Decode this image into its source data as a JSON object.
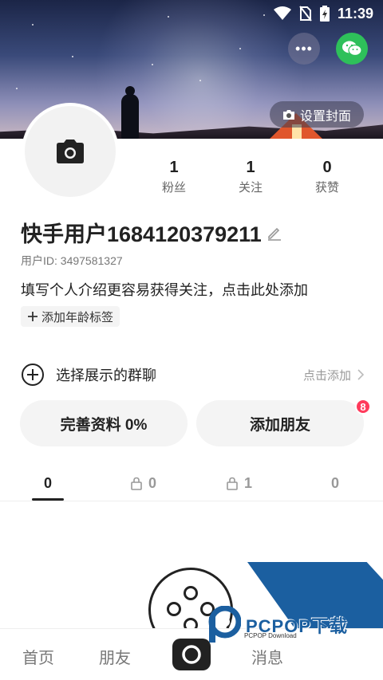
{
  "status_bar": {
    "time": "11:39"
  },
  "cover": {
    "set_cover_label": "设置封面",
    "more_label": "•••"
  },
  "profile": {
    "username": "快手用户1684120379211",
    "user_id": "用户ID: 3497581327",
    "bio_placeholder": "填写个人介绍更容易获得关注，点击此处添加",
    "age_tag_label": "添加年龄标签"
  },
  "stats": [
    {
      "value": "1",
      "label": "粉丝"
    },
    {
      "value": "1",
      "label": "关注"
    },
    {
      "value": "0",
      "label": "获赞"
    }
  ],
  "group_chat": {
    "title": "选择展示的群聊",
    "action": "点击添加"
  },
  "actions": {
    "complete_profile": "完善资料 0%",
    "add_friends": "添加朋友",
    "add_friends_badge": "8"
  },
  "content_tabs": [
    {
      "count": "0",
      "locked": false
    },
    {
      "count": "0",
      "locked": true
    },
    {
      "count": "1",
      "locked": true
    },
    {
      "count": "0",
      "locked": false
    }
  ],
  "bottom_nav": {
    "home": "首页",
    "friends": "朋友",
    "messages": "消息"
  },
  "watermark": {
    "brand": "PCPOP下载",
    "sub": "PCPOP Download"
  },
  "colors": {
    "accent_green": "#2ec05a",
    "badge_red": "#ff3b5c",
    "watermark_blue": "#1b5fa0"
  }
}
